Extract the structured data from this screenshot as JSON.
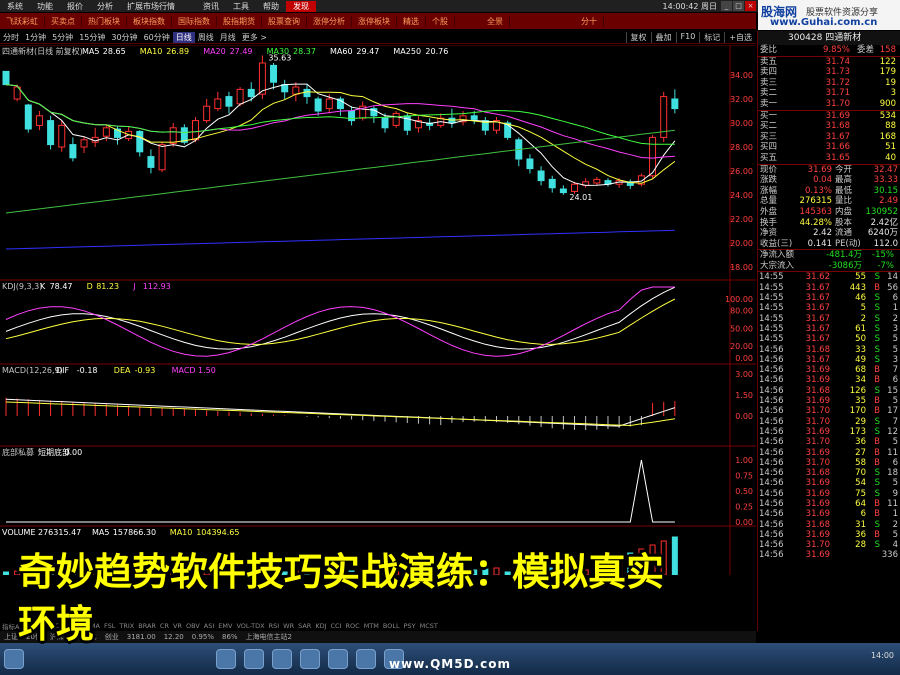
{
  "menu": {
    "items": [
      "系统",
      "功能",
      "报价",
      "分析",
      "扩展市场行情",
      "",
      "资讯",
      "工具",
      "帮助"
    ],
    "active": "发现",
    "ad": "",
    "clock": "14:00:42 周日"
  },
  "funcbar": {
    "items": [
      "飞跃彩虹",
      "买卖点",
      "热门板块",
      "板块指数",
      "国际指数",
      "股指期货",
      "股票查询",
      "涨停分析",
      "涨停板块",
      "精选",
      "个股",
      "",
      "",
      "全景",
      "",
      "",
      "",
      "",
      "",
      "分十"
    ]
  },
  "logo": {
    "brand_a": "股海网",
    "brand_b": "",
    "slogan": "股票软件资源分享",
    "url": "www.Guhai.com.cn"
  },
  "periods": {
    "tabs": [
      "分时",
      "1分钟",
      "5分钟",
      "15分钟",
      "30分钟",
      "60分钟",
      "日线",
      "周线",
      "月线",
      "更多 >"
    ],
    "selected": "日线",
    "right": [
      "复权",
      "叠加",
      "F10",
      "标记",
      "+自选"
    ]
  },
  "chart_data": [
    {
      "type": "candlestick",
      "title": "四通新材(日线 前复权)",
      "legend": [
        {
          "name": "MA5",
          "value": "28.65",
          "color": "#ffffff"
        },
        {
          "name": "MA10",
          "value": "26.89",
          "color": "#ffff40"
        },
        {
          "name": "MA20",
          "value": "27.49",
          "color": "#ff40ff"
        },
        {
          "name": "MA30",
          "value": "28.37",
          "color": "#40ff40"
        },
        {
          "name": "MA60",
          "value": "29.47",
          "color": "#ffffff"
        },
        {
          "name": "MA250",
          "value": "20.76",
          "color": "#ffffff"
        }
      ],
      "y_ticks": [
        "34.00",
        "32.00",
        "30.00",
        "28.00",
        "26.00",
        "24.00",
        "22.00",
        "20.00",
        "18.00"
      ],
      "ylim": [
        17.5,
        35.5
      ],
      "annotations": [
        "35.63",
        "24.01"
      ],
      "candles": [
        [
          34.3,
          33.2,
          31.5,
          31.5
        ],
        [
          32.0,
          33.0,
          33.2,
          31.8
        ],
        [
          31.5,
          29.5,
          29.2,
          31.6
        ],
        [
          29.8,
          30.6,
          29.4,
          31.0
        ],
        [
          30.2,
          28.2,
          27.8,
          30.6
        ],
        [
          28.0,
          29.8,
          27.6,
          30.2
        ],
        [
          28.2,
          27.1,
          26.8,
          28.8
        ],
        [
          28.0,
          28.6,
          27.5,
          28.9
        ],
        [
          28.4,
          28.8,
          28.0,
          29.6
        ],
        [
          28.9,
          29.6,
          28.5,
          29.9
        ],
        [
          29.5,
          28.8,
          28.2,
          29.7
        ],
        [
          28.7,
          29.3,
          28.5,
          29.7
        ],
        [
          29.3,
          27.6,
          27.2,
          29.4
        ],
        [
          27.2,
          26.3,
          25.8,
          27.8
        ],
        [
          26.1,
          28.2,
          25.9,
          28.4
        ],
        [
          28.3,
          29.6,
          28.0,
          30.0
        ],
        [
          29.6,
          28.4,
          28.2,
          29.9
        ],
        [
          28.6,
          30.2,
          28.4,
          30.5
        ],
        [
          30.2,
          31.4,
          30.0,
          32.0
        ],
        [
          31.2,
          32.0,
          31.0,
          32.6
        ],
        [
          32.2,
          31.4,
          30.8,
          32.6
        ],
        [
          31.6,
          32.8,
          31.4,
          33.0
        ],
        [
          32.8,
          32.2,
          31.8,
          33.4
        ],
        [
          32.4,
          35.0,
          32.0,
          35.63
        ],
        [
          34.8,
          33.4,
          32.8,
          35.0
        ],
        [
          33.2,
          32.6,
          32.0,
          33.6
        ],
        [
          32.4,
          33.0,
          31.8,
          33.4
        ],
        [
          32.8,
          32.2,
          31.6,
          33.2
        ],
        [
          32.0,
          31.0,
          30.6,
          32.2
        ],
        [
          31.2,
          32.0,
          30.8,
          32.4
        ],
        [
          32.0,
          31.2,
          30.6,
          32.2
        ],
        [
          31.0,
          30.2,
          29.8,
          31.4
        ],
        [
          30.4,
          31.4,
          30.2,
          31.8
        ],
        [
          31.2,
          30.6,
          30.0,
          31.4
        ],
        [
          30.4,
          29.6,
          29.2,
          30.8
        ],
        [
          29.8,
          30.8,
          29.6,
          31.0
        ],
        [
          30.6,
          29.4,
          29.0,
          30.8
        ],
        [
          29.6,
          30.2,
          29.2,
          30.6
        ],
        [
          30.0,
          29.8,
          29.4,
          30.4
        ],
        [
          29.8,
          30.4,
          29.6,
          30.8
        ],
        [
          30.4,
          30.0,
          29.6,
          31.2
        ],
        [
          30.1,
          30.6,
          29.8,
          31.0
        ],
        [
          30.6,
          30.3,
          29.9,
          31.0
        ],
        [
          30.2,
          29.4,
          29.0,
          30.5
        ],
        [
          29.4,
          30.2,
          29.1,
          30.5
        ],
        [
          30.0,
          28.8,
          28.6,
          30.2
        ],
        [
          28.6,
          27.0,
          26.4,
          28.8
        ],
        [
          27.0,
          26.2,
          25.8,
          27.4
        ],
        [
          26.0,
          25.2,
          24.8,
          26.4
        ],
        [
          25.3,
          24.6,
          24.2,
          25.6
        ],
        [
          24.5,
          24.2,
          24.01,
          24.8
        ],
        [
          24.3,
          24.9,
          24.1,
          25.1
        ],
        [
          24.8,
          25.1,
          24.6,
          25.4
        ],
        [
          25.0,
          25.3,
          24.8,
          25.5
        ],
        [
          25.2,
          24.9,
          24.7,
          25.4
        ],
        [
          24.9,
          25.2,
          24.6,
          25.4
        ],
        [
          25.1,
          24.8,
          24.5,
          25.3
        ],
        [
          24.9,
          25.6,
          24.7,
          25.8
        ],
        [
          25.6,
          28.8,
          25.4,
          29.0
        ],
        [
          28.8,
          32.2,
          28.4,
          32.6
        ],
        [
          32.0,
          31.2,
          30.8,
          32.8
        ]
      ]
    },
    {
      "type": "line",
      "title": "KDJ(9,3,3)",
      "legend": [
        {
          "name": "K",
          "value": "78.47",
          "color": "#ffffff"
        },
        {
          "name": "D",
          "value": "81.23",
          "color": "#ffff40"
        },
        {
          "name": "J",
          "value": "112.93",
          "color": "#ff40ff"
        }
      ],
      "y_ticks": [
        "100.00",
        "80.00",
        "50.00",
        "20.00",
        "0.00"
      ]
    },
    {
      "type": "bar",
      "title": "MACD(12,26,9)",
      "legend": [
        {
          "name": "DIF",
          "value": "-0.18",
          "color": "#ffffff"
        },
        {
          "name": "DEA",
          "value": "-0.93",
          "color": "#ffff40"
        },
        {
          "name": "MACD",
          "value": "1.50",
          "color": "#ff40ff"
        }
      ],
      "y_ticks": [
        "3.00",
        "1.50",
        "0.00"
      ]
    },
    {
      "type": "line",
      "title": "底部私募",
      "legend": [
        {
          "name": "短期底部",
          "value": "0.00",
          "color": "#ffffff"
        }
      ],
      "y_ticks": [
        "1.00",
        "0.75",
        "0.50",
        "0.25",
        "0.00"
      ]
    },
    {
      "type": "bar",
      "title": "VOLUME",
      "legend": [
        {
          "name": "VOLUME",
          "value": "276315.47",
          "color": "#ffffff"
        },
        {
          "name": "MA5",
          "value": "157866.30",
          "color": "#ffffff"
        },
        {
          "name": "MA10",
          "value": "104394.65",
          "color": "#ffff40"
        }
      ]
    }
  ],
  "quote": {
    "code": "300428 四通新材",
    "header": {
      "label": "委比",
      "value": "9.85%",
      "label2": "委差",
      "value2": "158"
    },
    "asks": [
      {
        "label": "卖五",
        "price": "31.74",
        "vol": "122"
      },
      {
        "label": "卖四",
        "price": "31.73",
        "vol": "179"
      },
      {
        "label": "卖三",
        "price": "31.72",
        "vol": "19"
      },
      {
        "label": "卖二",
        "price": "31.71",
        "vol": "3"
      },
      {
        "label": "卖一",
        "price": "31.70",
        "vol": "900"
      }
    ],
    "bids": [
      {
        "label": "买一",
        "price": "31.69",
        "vol": "534"
      },
      {
        "label": "买二",
        "price": "31.68",
        "vol": "88"
      },
      {
        "label": "买三",
        "price": "31.67",
        "vol": "168"
      },
      {
        "label": "买四",
        "price": "31.66",
        "vol": "51"
      },
      {
        "label": "买五",
        "price": "31.65",
        "vol": "40"
      }
    ],
    "stats": [
      {
        "l1": "现价",
        "v1": "31.69",
        "l2": "今开",
        "v2": "32.47"
      },
      {
        "l1": "涨跌",
        "v1": "0.04",
        "l2": "最高",
        "v2": "33.33"
      },
      {
        "l1": "涨幅",
        "v1": "0.13%",
        "l2": "最低",
        "v2": "30.15"
      },
      {
        "l1": "总量",
        "v1": "276315",
        "l2": "量比",
        "v2": "2.49"
      },
      {
        "l1": "外盘",
        "v1": "145363",
        "l2": "内盘",
        "v2": "130952"
      },
      {
        "l1": "换手",
        "v1": "44.28%",
        "l2": "股本",
        "v2": "2.42亿"
      },
      {
        "l1": "净资",
        "v1": "2.42",
        "l2": "流通",
        "v2": "6240万"
      },
      {
        "l1": "收益(三)",
        "v1": "0.141",
        "l2": "PE(动)",
        "v2": "112.0"
      }
    ],
    "flows": [
      {
        "l": "净流入额",
        "v": "-481.4万",
        "n": "-15%"
      },
      {
        "l": "大宗流入",
        "v": "-3086万",
        "n": "-7%"
      }
    ],
    "ticks": [
      [
        "14:55",
        "31.62",
        "55",
        "S",
        "14"
      ],
      [
        "14:55",
        "31.67",
        "443",
        "B",
        "56"
      ],
      [
        "14:55",
        "31.67",
        "46",
        "S",
        "6"
      ],
      [
        "14:55",
        "31.67",
        "5",
        "S",
        "1"
      ],
      [
        "14:55",
        "31.67",
        "2",
        "S",
        "2"
      ],
      [
        "14:55",
        "31.67",
        "61",
        "S",
        "3"
      ],
      [
        "14:55",
        "31.67",
        "50",
        "S",
        "5"
      ],
      [
        "14:56",
        "31.68",
        "33",
        "S",
        "5"
      ],
      [
        "14:56",
        "31.67",
        "49",
        "S",
        "3"
      ],
      [
        "14:56",
        "31.69",
        "68",
        "B",
        "7"
      ],
      [
        "14:56",
        "31.69",
        "34",
        "B",
        "6"
      ],
      [
        "14:56",
        "31.68",
        "126",
        "S",
        "15"
      ],
      [
        "14:56",
        "31.69",
        "35",
        "B",
        "5"
      ],
      [
        "14:56",
        "31.70",
        "170",
        "B",
        "17"
      ],
      [
        "14:56",
        "31.70",
        "29",
        "S",
        "7"
      ],
      [
        "14:56",
        "31.69",
        "173",
        "S",
        "12"
      ],
      [
        "14:56",
        "31.70",
        "36",
        "B",
        "5"
      ],
      [
        "14:56",
        "31.69",
        "27",
        "B",
        "11"
      ],
      [
        "14:56",
        "31.70",
        "58",
        "B",
        "6"
      ],
      [
        "14:56",
        "31.68",
        "70",
        "S",
        "18"
      ],
      [
        "14:56",
        "31.69",
        "54",
        "S",
        "5"
      ],
      [
        "14:56",
        "31.69",
        "75",
        "S",
        "9"
      ],
      [
        "14:56",
        "31.69",
        "64",
        "B",
        "11"
      ],
      [
        "14:56",
        "31.69",
        "6",
        "B",
        "1"
      ],
      [
        "14:56",
        "31.68",
        "31",
        "S",
        "2"
      ],
      [
        "14:56",
        "31.69",
        "36",
        "B",
        "5"
      ],
      [
        "14:56",
        "31.70",
        "28",
        "S",
        "4"
      ],
      [
        "14:56",
        "31.69",
        "",
        "",
        "336"
      ]
    ]
  },
  "indicators": [
    "指标A",
    "指标B",
    "MACD",
    "DMI",
    "DMA",
    "FSL",
    "TRIX",
    "BRAR",
    "CR",
    "VR",
    "OBV",
    "ASI",
    "EMV",
    "VOL-TDX",
    "RSI",
    "WR",
    "SAR",
    "KDJ",
    "CCI",
    "ROC",
    "MTM",
    "BOLL",
    "PSY",
    "MCST"
  ],
  "status": [
    "上证",
    "20亿",
    "沪深",
    "1071亿",
    "创业",
    "3181.00",
    "12.20",
    "0.95%",
    "86%",
    "上海电信主站2"
  ],
  "caption": {
    "line1": "奇妙趋势软件技巧实战演练：模拟真实",
    "line2": "环境"
  },
  "watermark": "www.QM5D.com",
  "taskbar": {
    "time": "14:00"
  }
}
